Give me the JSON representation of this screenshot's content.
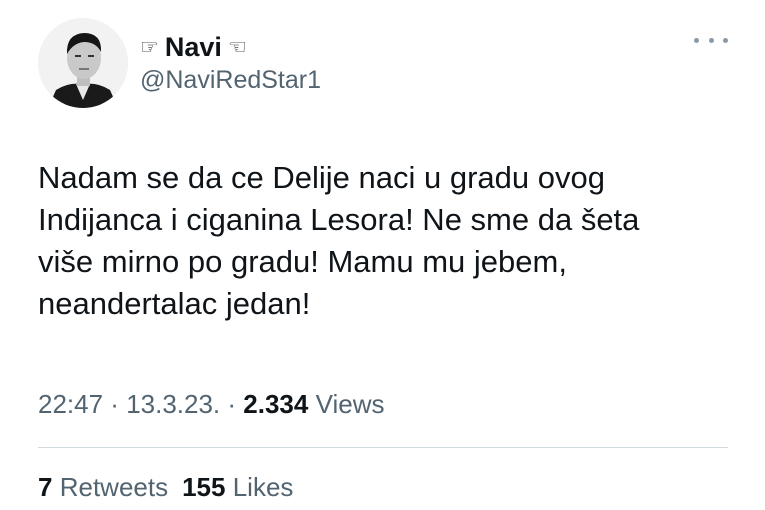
{
  "author": {
    "display_name": "Navi",
    "name_left_icon": "pointing-hand-right",
    "name_right_icon": "pointing-hand-left",
    "handle": "@NaviRedStar1",
    "avatar": "profile-photo"
  },
  "more_icon": "ellipsis-icon",
  "tweet": {
    "text": "Nadam se da ce Delije naci u gradu ovog\nIndijanca i ciganina Lesora! Ne sme da šeta\nviše mirno po gradu! Mamu mu jebem,\nneandertalac jedan!",
    "time": "22:47",
    "sep1": " · ",
    "date": "13.3.23.",
    "sep2": " · ",
    "views_count": "2.334",
    "views_label": "Views"
  },
  "stats": {
    "retweets_count": "7",
    "retweets_label": "Retweets",
    "likes_count": "155",
    "likes_label": "Likes"
  },
  "colors": {
    "text": "#0f1419",
    "secondary": "#536471",
    "divider": "#cfd9de"
  }
}
